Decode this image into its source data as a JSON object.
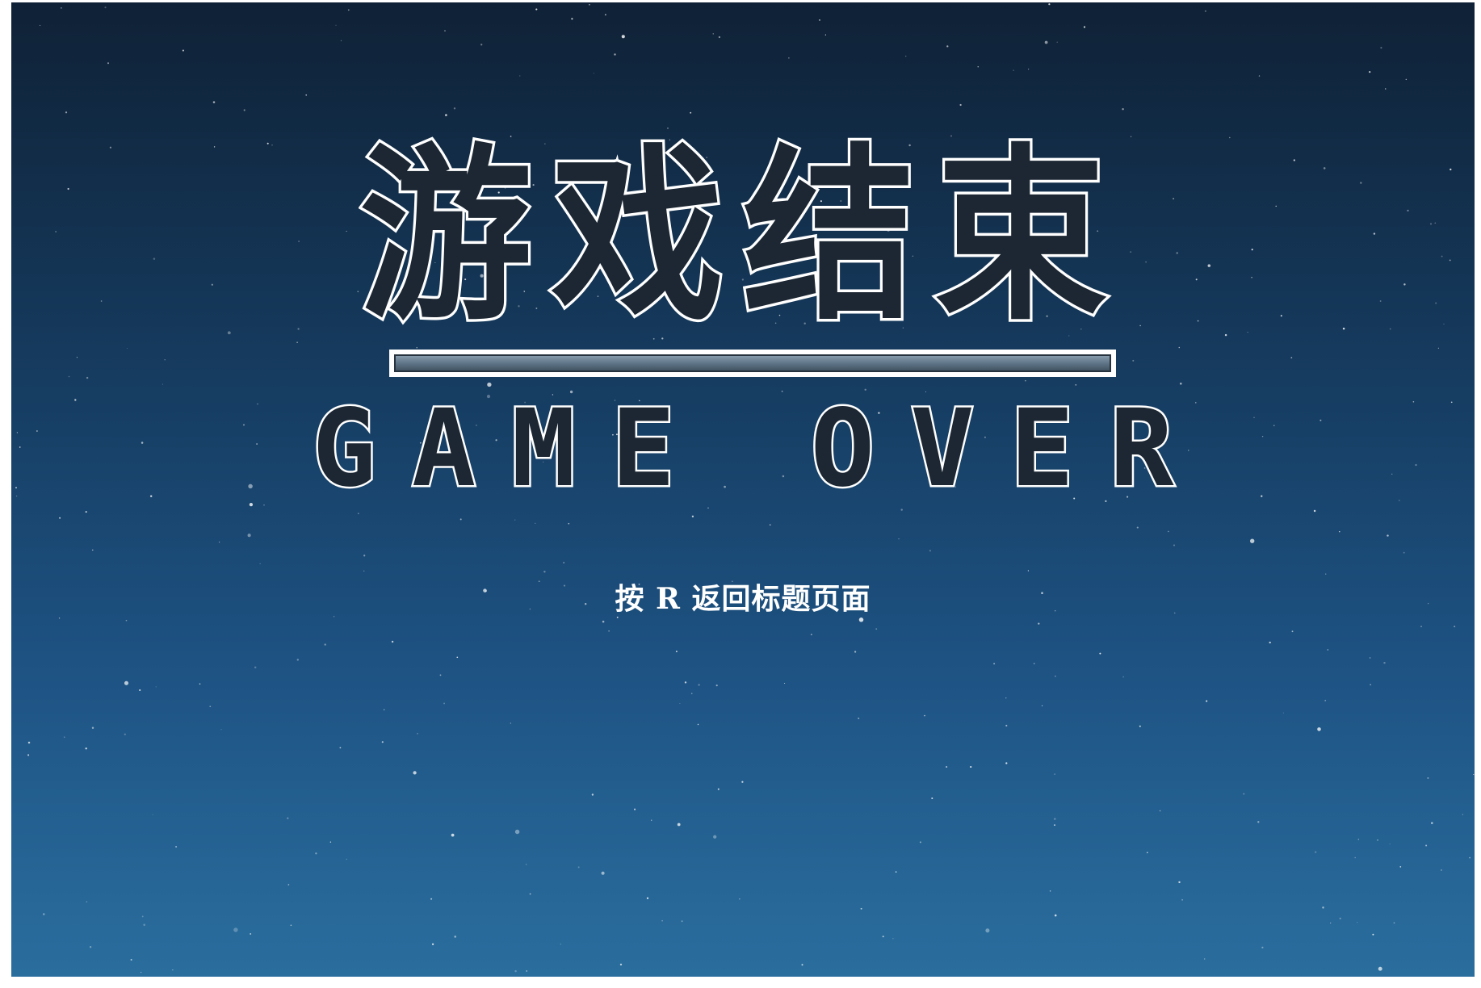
{
  "screen": {
    "title_cn": "游戏结束",
    "title_en": "GAME OVER",
    "prompt": "按 R 返回标题页面"
  },
  "colors": {
    "sky_top": "#0f2136",
    "sky_bottom": "#2a6e9e",
    "title_fill": "#1c2733",
    "title_outline": "#ffffff",
    "prompt_text": "#ffffff"
  }
}
